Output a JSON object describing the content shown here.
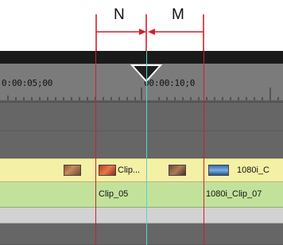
{
  "annotation": {
    "left_label": "N",
    "right_label": "M"
  },
  "ruler": {
    "timecode_left": "0:00:05;00",
    "timecode_center": "00:00:10;0"
  },
  "tracks": {
    "video_track": {
      "clip_middle_label": "Clip...",
      "clip_right_label": "1080i_C"
    },
    "audio_track": {
      "clip_left_label": "Clip_05",
      "clip_right_label": "1080i_Clip_07"
    }
  },
  "colors": {
    "annotation_red": "#d31f2a",
    "playhead_cyan": "#4fd6cf",
    "video_track": "#f4f0a6",
    "audio_track": "#c2e29c"
  }
}
